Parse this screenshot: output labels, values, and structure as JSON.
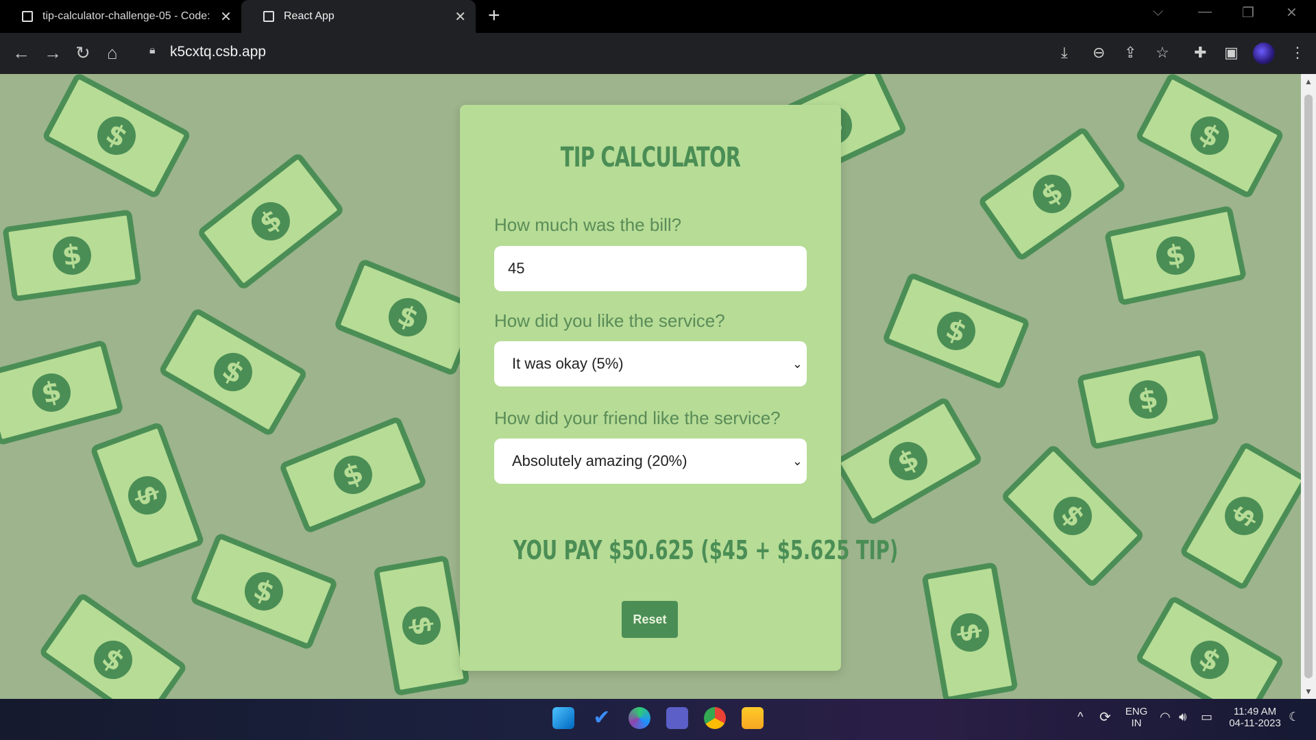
{
  "browser": {
    "tabs": [
      {
        "title": "tip-calculator-challenge-05 - Code:"
      },
      {
        "title": "React App"
      }
    ],
    "url": "k5cxtq.csb.app"
  },
  "app": {
    "title": "TIP CALCULATOR",
    "bill_label": "How much was the bill?",
    "bill_value": "45",
    "service_label": "How did you like the service?",
    "service_value": "It was okay (5%)",
    "friend_label": "How did your friend like the service?",
    "friend_value": "Absolutely amazing (20%)",
    "total_text": "YOU PAY $50.625 ($45 + $5.625 TIP)",
    "reset_label": "Reset"
  },
  "taskbar": {
    "language_top": "ENG",
    "language_bottom": "IN",
    "time": "11:49 AM",
    "date": "04-11-2023"
  },
  "colors": {
    "background": "#9db48c",
    "card": "#b6dc96",
    "accent": "#4b8e55"
  }
}
